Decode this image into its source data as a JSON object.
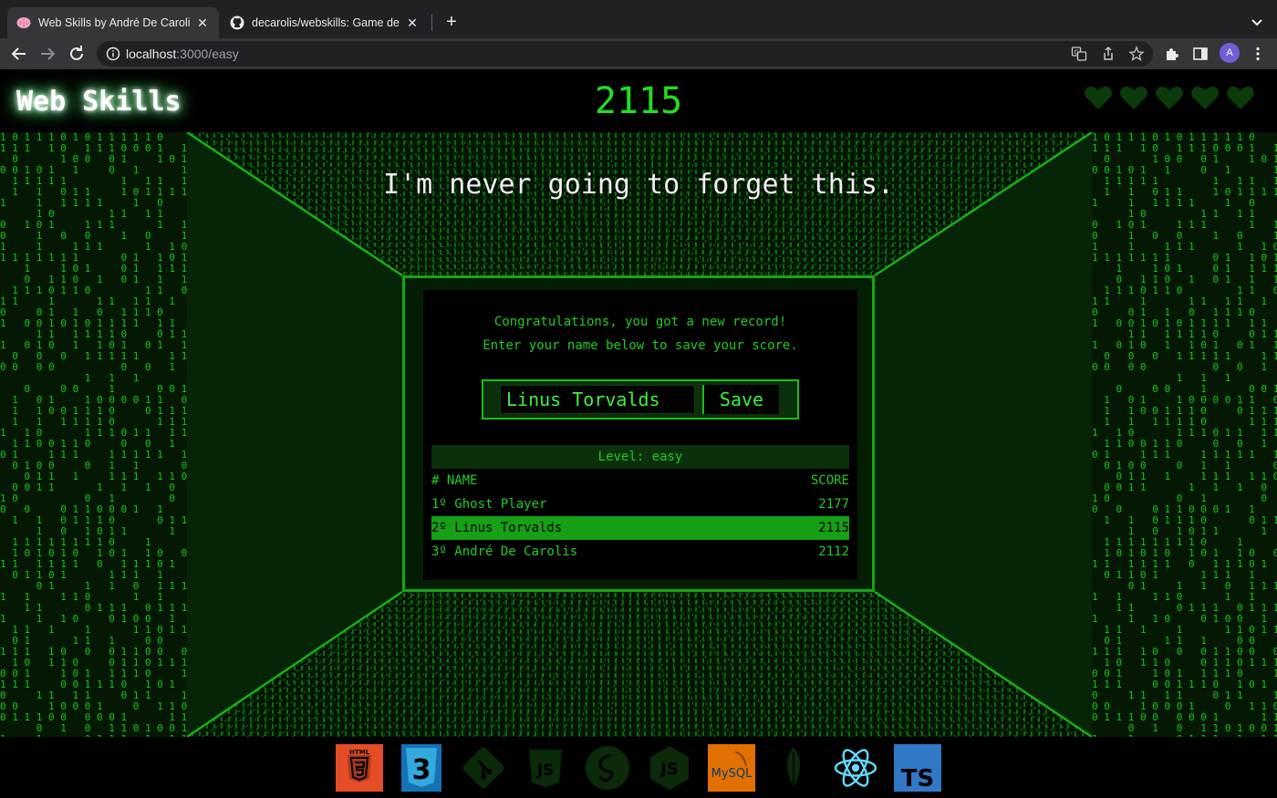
{
  "browser": {
    "tabs": [
      {
        "title": "Web Skills by André De Carolis",
        "active": true,
        "icon": "brain-icon"
      },
      {
        "title": "decarolis/webskills: Game developed...",
        "active": false,
        "icon": "github-icon"
      }
    ],
    "url_host": "localhost",
    "url_path": ":3000/easy",
    "profile_initial": "A"
  },
  "game": {
    "logo": "Web Skills",
    "score": "2115",
    "lives": 5,
    "quote": "I'm never going to forget this.",
    "congrats_line1": "Congratulations, you got a new record!",
    "congrats_line2": "Enter your name below to save your score.",
    "name_value": "Linus Torvalds",
    "save_label": "Save",
    "level_label": "Level: easy",
    "table": {
      "col_name": "# NAME",
      "col_score": "SCORE",
      "rows": [
        {
          "name": "1º Ghost Player",
          "score": "2177",
          "highlight": false
        },
        {
          "name": "2º Linus Torvalds",
          "score": "2115",
          "highlight": true
        },
        {
          "name": "3º André De Carolis",
          "score": "2112",
          "highlight": false
        }
      ]
    }
  },
  "footer": {
    "techs": [
      {
        "name": "html5-icon",
        "label": "HTML",
        "active": true,
        "color": "#e44d26"
      },
      {
        "name": "css3-icon",
        "label": "3",
        "active": true,
        "color": "#1572b6"
      },
      {
        "name": "git-icon",
        "active": false
      },
      {
        "name": "javascript-icon",
        "label": "JS",
        "active": false
      },
      {
        "name": "sass-icon",
        "active": false
      },
      {
        "name": "nodejs-icon",
        "label": "JS",
        "active": false
      },
      {
        "name": "mysql-icon",
        "label": "MySQL",
        "active": true,
        "color": "#e48e00"
      },
      {
        "name": "mongodb-icon",
        "active": false
      },
      {
        "name": "react-icon",
        "active": true,
        "color": "#61dafb"
      },
      {
        "name": "typescript-icon",
        "label": "TS",
        "active": true,
        "color": "#3178c6"
      }
    ]
  },
  "colors": {
    "matrix_green": "#22dd22",
    "panel_border": "#16a516",
    "highlight_row": "#15a015"
  }
}
